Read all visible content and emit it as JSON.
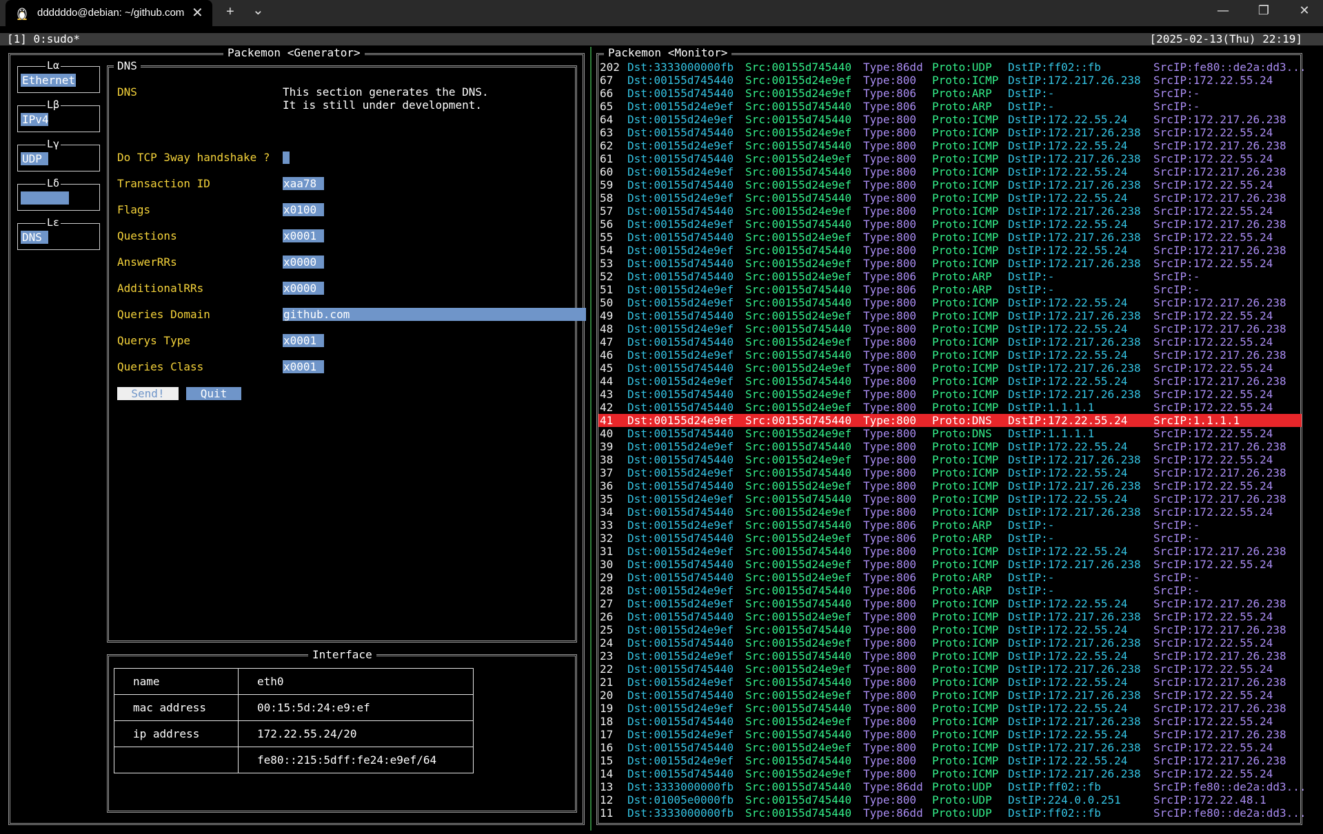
{
  "window": {
    "tab_title": "ddddddo@debian: ~/github.com",
    "new_tab_symbol": "+",
    "dropdown_symbol": "⌄",
    "close_tab_symbol": "✕",
    "minimize_symbol": "—",
    "restore_symbol": "❐",
    "close_window_symbol": "✕"
  },
  "tmux": {
    "session": "[1] 0:sudo*",
    "clock": "[2025-02-13(Thu) 22:19]"
  },
  "generator": {
    "title": "Packemon <Generator>",
    "layers": [
      {
        "title": "Lα",
        "value": "Ethernet"
      },
      {
        "title": "Lβ",
        "value": "IPv4"
      },
      {
        "title": "Lγ",
        "value": "UDP"
      },
      {
        "title": "Lδ",
        "value": ""
      },
      {
        "title": "Lε",
        "value": "DNS"
      }
    ],
    "form": {
      "title": "DNS",
      "heading_label": "DNS",
      "description_line1": "This section generates the DNS.",
      "description_line2": "It is still under development.",
      "handshake_label": "Do TCP 3way handshake ?",
      "fields": [
        {
          "label": "Transaction ID",
          "value": "xaa78"
        },
        {
          "label": "Flags",
          "value": "x0100"
        },
        {
          "label": "Questions",
          "value": "x0001"
        },
        {
          "label": "AnswerRRs",
          "value": "x0000"
        },
        {
          "label": "AdditionalRRs",
          "value": "x0000"
        },
        {
          "label": "Queries Domain",
          "value": "github.com"
        },
        {
          "label": "Querys Type",
          "value": "x0001"
        },
        {
          "label": "Queries Class",
          "value": "x0001"
        }
      ],
      "send_label": "Send!",
      "quit_label": "Quit"
    },
    "interface": {
      "title": "Interface",
      "rows": [
        {
          "key": "name",
          "value": "eth0"
        },
        {
          "key": "mac address",
          "value": "00:15:5d:24:e9:ef"
        },
        {
          "key": "ip address",
          "value": "172.22.55.24/20"
        },
        {
          "key": "",
          "value": "fe80::215:5dff:fe24:e9ef/64"
        }
      ]
    }
  },
  "monitor": {
    "title": "Packemon <Monitor>",
    "highlight_color": "#e8262a",
    "rows": [
      [
        "202",
        "Dst:3333000000fb",
        "Src:00155d745440",
        "Type:86dd",
        "Proto:UDP",
        "DstIP:ff02::fb",
        "SrcIP:fe80::de2a:dd3..."
      ],
      [
        "67",
        "Dst:00155d745440",
        "Src:00155d24e9ef",
        "Type:800",
        "Proto:ICMP",
        "DstIP:172.217.26.238",
        "SrcIP:172.22.55.24"
      ],
      [
        "66",
        "Dst:00155d745440",
        "Src:00155d24e9ef",
        "Type:806",
        "Proto:ARP",
        "DstIP:-",
        "SrcIP:-"
      ],
      [
        "65",
        "Dst:00155d24e9ef",
        "Src:00155d745440",
        "Type:806",
        "Proto:ARP",
        "DstIP:-",
        "SrcIP:-"
      ],
      [
        "64",
        "Dst:00155d24e9ef",
        "Src:00155d745440",
        "Type:800",
        "Proto:ICMP",
        "DstIP:172.22.55.24",
        "SrcIP:172.217.26.238"
      ],
      [
        "63",
        "Dst:00155d745440",
        "Src:00155d24e9ef",
        "Type:800",
        "Proto:ICMP",
        "DstIP:172.217.26.238",
        "SrcIP:172.22.55.24"
      ],
      [
        "62",
        "Dst:00155d24e9ef",
        "Src:00155d745440",
        "Type:800",
        "Proto:ICMP",
        "DstIP:172.22.55.24",
        "SrcIP:172.217.26.238"
      ],
      [
        "61",
        "Dst:00155d745440",
        "Src:00155d24e9ef",
        "Type:800",
        "Proto:ICMP",
        "DstIP:172.217.26.238",
        "SrcIP:172.22.55.24"
      ],
      [
        "60",
        "Dst:00155d24e9ef",
        "Src:00155d745440",
        "Type:800",
        "Proto:ICMP",
        "DstIP:172.22.55.24",
        "SrcIP:172.217.26.238"
      ],
      [
        "59",
        "Dst:00155d745440",
        "Src:00155d24e9ef",
        "Type:800",
        "Proto:ICMP",
        "DstIP:172.217.26.238",
        "SrcIP:172.22.55.24"
      ],
      [
        "58",
        "Dst:00155d24e9ef",
        "Src:00155d745440",
        "Type:800",
        "Proto:ICMP",
        "DstIP:172.22.55.24",
        "SrcIP:172.217.26.238"
      ],
      [
        "57",
        "Dst:00155d745440",
        "Src:00155d24e9ef",
        "Type:800",
        "Proto:ICMP",
        "DstIP:172.217.26.238",
        "SrcIP:172.22.55.24"
      ],
      [
        "56",
        "Dst:00155d24e9ef",
        "Src:00155d745440",
        "Type:800",
        "Proto:ICMP",
        "DstIP:172.22.55.24",
        "SrcIP:172.217.26.238"
      ],
      [
        "55",
        "Dst:00155d745440",
        "Src:00155d24e9ef",
        "Type:800",
        "Proto:ICMP",
        "DstIP:172.217.26.238",
        "SrcIP:172.22.55.24"
      ],
      [
        "54",
        "Dst:00155d24e9ef",
        "Src:00155d745440",
        "Type:800",
        "Proto:ICMP",
        "DstIP:172.22.55.24",
        "SrcIP:172.217.26.238"
      ],
      [
        "53",
        "Dst:00155d745440",
        "Src:00155d24e9ef",
        "Type:800",
        "Proto:ICMP",
        "DstIP:172.217.26.238",
        "SrcIP:172.22.55.24"
      ],
      [
        "52",
        "Dst:00155d745440",
        "Src:00155d24e9ef",
        "Type:806",
        "Proto:ARP",
        "DstIP:-",
        "SrcIP:-"
      ],
      [
        "51",
        "Dst:00155d24e9ef",
        "Src:00155d745440",
        "Type:806",
        "Proto:ARP",
        "DstIP:-",
        "SrcIP:-"
      ],
      [
        "50",
        "Dst:00155d24e9ef",
        "Src:00155d745440",
        "Type:800",
        "Proto:ICMP",
        "DstIP:172.22.55.24",
        "SrcIP:172.217.26.238"
      ],
      [
        "49",
        "Dst:00155d745440",
        "Src:00155d24e9ef",
        "Type:800",
        "Proto:ICMP",
        "DstIP:172.217.26.238",
        "SrcIP:172.22.55.24"
      ],
      [
        "48",
        "Dst:00155d24e9ef",
        "Src:00155d745440",
        "Type:800",
        "Proto:ICMP",
        "DstIP:172.22.55.24",
        "SrcIP:172.217.26.238"
      ],
      [
        "47",
        "Dst:00155d745440",
        "Src:00155d24e9ef",
        "Type:800",
        "Proto:ICMP",
        "DstIP:172.217.26.238",
        "SrcIP:172.22.55.24"
      ],
      [
        "46",
        "Dst:00155d24e9ef",
        "Src:00155d745440",
        "Type:800",
        "Proto:ICMP",
        "DstIP:172.22.55.24",
        "SrcIP:172.217.26.238"
      ],
      [
        "45",
        "Dst:00155d745440",
        "Src:00155d24e9ef",
        "Type:800",
        "Proto:ICMP",
        "DstIP:172.217.26.238",
        "SrcIP:172.22.55.24"
      ],
      [
        "44",
        "Dst:00155d24e9ef",
        "Src:00155d745440",
        "Type:800",
        "Proto:ICMP",
        "DstIP:172.22.55.24",
        "SrcIP:172.217.26.238"
      ],
      [
        "43",
        "Dst:00155d745440",
        "Src:00155d24e9ef",
        "Type:800",
        "Proto:ICMP",
        "DstIP:172.217.26.238",
        "SrcIP:172.22.55.24"
      ],
      [
        "42",
        "Dst:00155d745440",
        "Src:00155d24e9ef",
        "Type:800",
        "Proto:ICMP",
        "DstIP:1.1.1.1",
        "SrcIP:172.22.55.24"
      ],
      [
        "41",
        "Dst:00155d24e9ef",
        "Src:00155d745440",
        "Type:800",
        "Proto:DNS",
        "DstIP:172.22.55.24",
        "SrcIP:1.1.1.1"
      ],
      [
        "40",
        "Dst:00155d745440",
        "Src:00155d24e9ef",
        "Type:800",
        "Proto:DNS",
        "DstIP:1.1.1.1",
        "SrcIP:172.22.55.24"
      ],
      [
        "39",
        "Dst:00155d24e9ef",
        "Src:00155d745440",
        "Type:800",
        "Proto:ICMP",
        "DstIP:172.22.55.24",
        "SrcIP:172.217.26.238"
      ],
      [
        "38",
        "Dst:00155d745440",
        "Src:00155d24e9ef",
        "Type:800",
        "Proto:ICMP",
        "DstIP:172.217.26.238",
        "SrcIP:172.22.55.24"
      ],
      [
        "37",
        "Dst:00155d24e9ef",
        "Src:00155d745440",
        "Type:800",
        "Proto:ICMP",
        "DstIP:172.22.55.24",
        "SrcIP:172.217.26.238"
      ],
      [
        "36",
        "Dst:00155d745440",
        "Src:00155d24e9ef",
        "Type:800",
        "Proto:ICMP",
        "DstIP:172.217.26.238",
        "SrcIP:172.22.55.24"
      ],
      [
        "35",
        "Dst:00155d24e9ef",
        "Src:00155d745440",
        "Type:800",
        "Proto:ICMP",
        "DstIP:172.22.55.24",
        "SrcIP:172.217.26.238"
      ],
      [
        "34",
        "Dst:00155d745440",
        "Src:00155d24e9ef",
        "Type:800",
        "Proto:ICMP",
        "DstIP:172.217.26.238",
        "SrcIP:172.22.55.24"
      ],
      [
        "33",
        "Dst:00155d24e9ef",
        "Src:00155d745440",
        "Type:806",
        "Proto:ARP",
        "DstIP:-",
        "SrcIP:-"
      ],
      [
        "32",
        "Dst:00155d745440",
        "Src:00155d24e9ef",
        "Type:806",
        "Proto:ARP",
        "DstIP:-",
        "SrcIP:-"
      ],
      [
        "31",
        "Dst:00155d24e9ef",
        "Src:00155d745440",
        "Type:800",
        "Proto:ICMP",
        "DstIP:172.22.55.24",
        "SrcIP:172.217.26.238"
      ],
      [
        "30",
        "Dst:00155d745440",
        "Src:00155d24e9ef",
        "Type:800",
        "Proto:ICMP",
        "DstIP:172.217.26.238",
        "SrcIP:172.22.55.24"
      ],
      [
        "29",
        "Dst:00155d745440",
        "Src:00155d24e9ef",
        "Type:806",
        "Proto:ARP",
        "DstIP:-",
        "SrcIP:-"
      ],
      [
        "28",
        "Dst:00155d24e9ef",
        "Src:00155d745440",
        "Type:806",
        "Proto:ARP",
        "DstIP:-",
        "SrcIP:-"
      ],
      [
        "27",
        "Dst:00155d24e9ef",
        "Src:00155d745440",
        "Type:800",
        "Proto:ICMP",
        "DstIP:172.22.55.24",
        "SrcIP:172.217.26.238"
      ],
      [
        "26",
        "Dst:00155d745440",
        "Src:00155d24e9ef",
        "Type:800",
        "Proto:ICMP",
        "DstIP:172.217.26.238",
        "SrcIP:172.22.55.24"
      ],
      [
        "25",
        "Dst:00155d24e9ef",
        "Src:00155d745440",
        "Type:800",
        "Proto:ICMP",
        "DstIP:172.22.55.24",
        "SrcIP:172.217.26.238"
      ],
      [
        "24",
        "Dst:00155d745440",
        "Src:00155d24e9ef",
        "Type:800",
        "Proto:ICMP",
        "DstIP:172.217.26.238",
        "SrcIP:172.22.55.24"
      ],
      [
        "23",
        "Dst:00155d24e9ef",
        "Src:00155d745440",
        "Type:800",
        "Proto:ICMP",
        "DstIP:172.22.55.24",
        "SrcIP:172.217.26.238"
      ],
      [
        "22",
        "Dst:00155d745440",
        "Src:00155d24e9ef",
        "Type:800",
        "Proto:ICMP",
        "DstIP:172.217.26.238",
        "SrcIP:172.22.55.24"
      ],
      [
        "21",
        "Dst:00155d24e9ef",
        "Src:00155d745440",
        "Type:800",
        "Proto:ICMP",
        "DstIP:172.22.55.24",
        "SrcIP:172.217.26.238"
      ],
      [
        "20",
        "Dst:00155d745440",
        "Src:00155d24e9ef",
        "Type:800",
        "Proto:ICMP",
        "DstIP:172.217.26.238",
        "SrcIP:172.22.55.24"
      ],
      [
        "19",
        "Dst:00155d24e9ef",
        "Src:00155d745440",
        "Type:800",
        "Proto:ICMP",
        "DstIP:172.22.55.24",
        "SrcIP:172.217.26.238"
      ],
      [
        "18",
        "Dst:00155d745440",
        "Src:00155d24e9ef",
        "Type:800",
        "Proto:ICMP",
        "DstIP:172.217.26.238",
        "SrcIP:172.22.55.24"
      ],
      [
        "17",
        "Dst:00155d24e9ef",
        "Src:00155d745440",
        "Type:800",
        "Proto:ICMP",
        "DstIP:172.22.55.24",
        "SrcIP:172.217.26.238"
      ],
      [
        "16",
        "Dst:00155d745440",
        "Src:00155d24e9ef",
        "Type:800",
        "Proto:ICMP",
        "DstIP:172.217.26.238",
        "SrcIP:172.22.55.24"
      ],
      [
        "15",
        "Dst:00155d24e9ef",
        "Src:00155d745440",
        "Type:800",
        "Proto:ICMP",
        "DstIP:172.22.55.24",
        "SrcIP:172.217.26.238"
      ],
      [
        "14",
        "Dst:00155d745440",
        "Src:00155d24e9ef",
        "Type:800",
        "Proto:ICMP",
        "DstIP:172.217.26.238",
        "SrcIP:172.22.55.24"
      ],
      [
        "13",
        "Dst:3333000000fb",
        "Src:00155d745440",
        "Type:86dd",
        "Proto:UDP",
        "DstIP:ff02::fb",
        "SrcIP:fe80::de2a:dd3..."
      ],
      [
        "12",
        "Dst:01005e0000fb",
        "Src:00155d745440",
        "Type:800",
        "Proto:UDP",
        "DstIP:224.0.0.251",
        "SrcIP:172.22.48.1"
      ],
      [
        "11",
        "Dst:3333000000fb",
        "Src:00155d745440",
        "Type:86dd",
        "Proto:UDP",
        "DstIP:ff02::fb",
        "SrcIP:fe80::de2a:dd3..."
      ]
    ],
    "highlighted_row": "41"
  }
}
